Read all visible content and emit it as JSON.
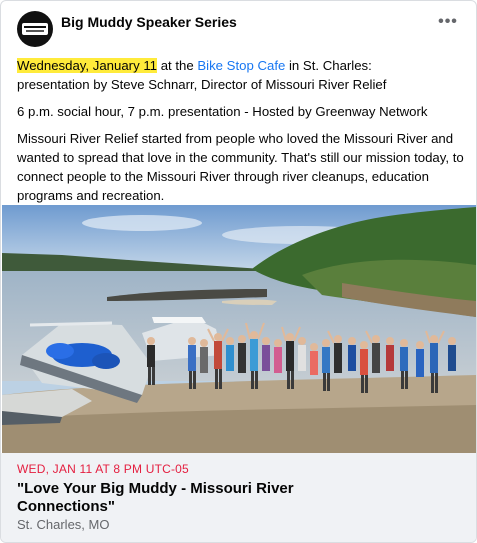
{
  "post": {
    "page_name": "Big Muddy Speaker Series",
    "paragraph1": {
      "date_highlight": "Wednesday, January 11",
      "text_before_venue": " at the ",
      "venue": "Bike Stop Cafe",
      "text_after_venue": " in St. Charles:",
      "line2": " presentation by Steve Schnarr, Director of Missouri River Relief"
    },
    "paragraph2": "6 p.m. social hour, 7 p.m. presentation - Hosted by Greenway Network",
    "paragraph3": "Missouri River Relief started from people who loved the Missouri River and wanted to spread that love in the community. That's still our mission today, to connect people to the Missouri River through river cleanups, education programs and recreation."
  },
  "event": {
    "date": "WED, JAN 11 AT 8 PM UTC-05",
    "title": "\"Love Your Big Muddy - Missouri River Connections\"",
    "location": "St. Charles, MO"
  },
  "icons": {
    "avatar": "big-muddy-logo",
    "more": "more-options-icon"
  },
  "colors": {
    "highlight": "#ffeb3b",
    "link": "#1877f2",
    "event_date": "#e41e3f",
    "footer_bg": "#f0f2f5"
  }
}
